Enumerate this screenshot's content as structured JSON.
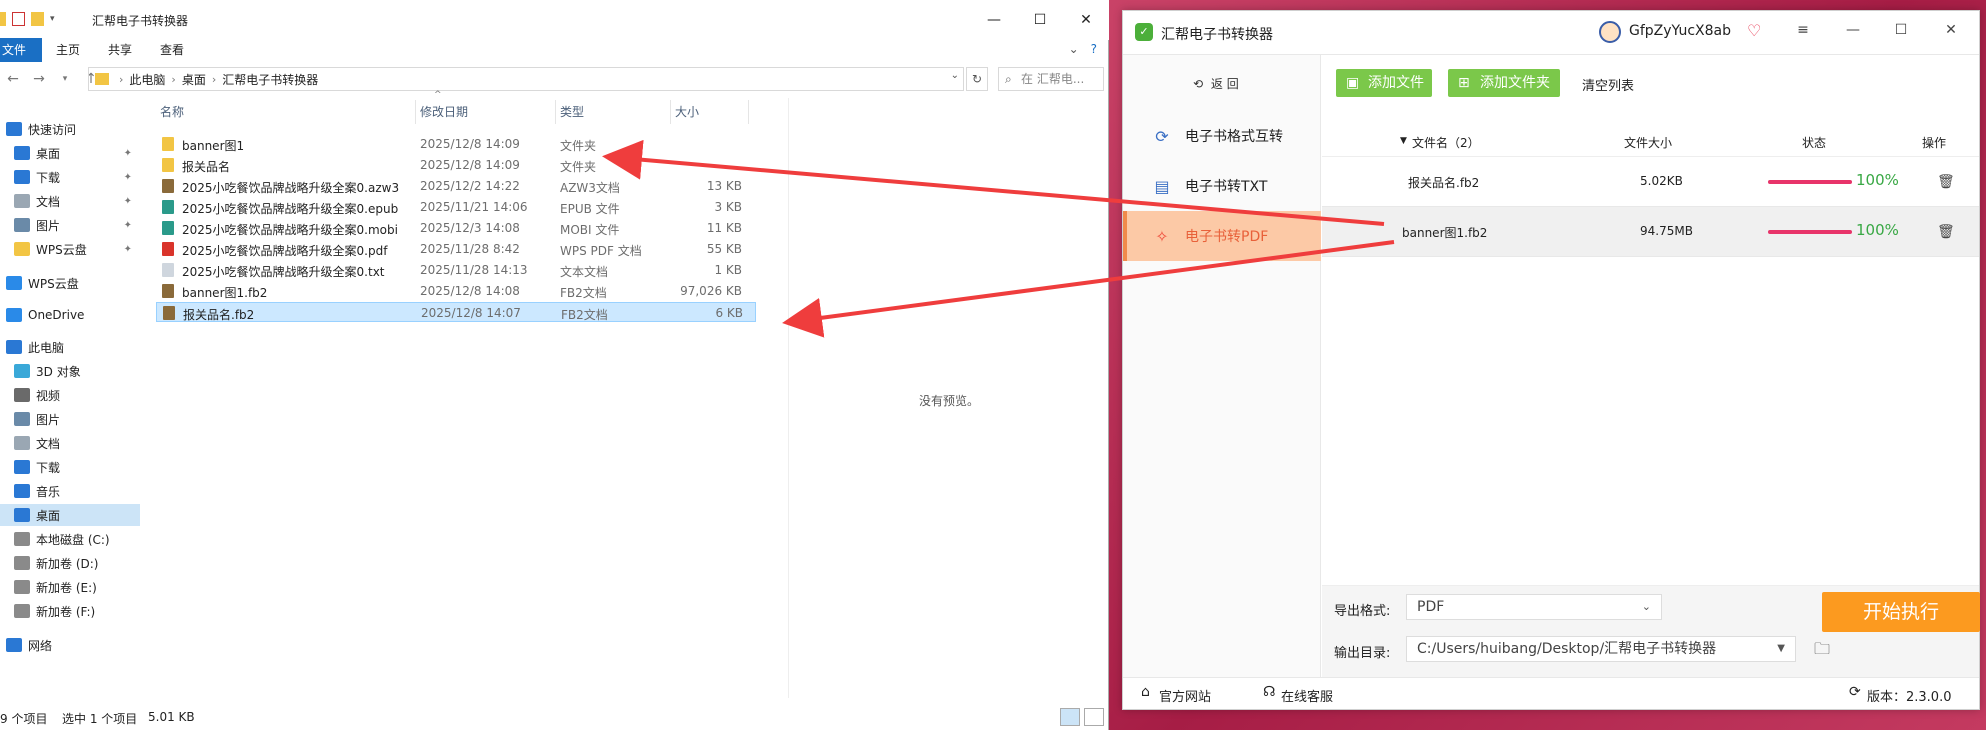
{
  "explorer": {
    "title": "汇帮电子书转换器",
    "ribbon": {
      "file": "文件",
      "home": "主页",
      "share": "共享",
      "view": "查看"
    },
    "breadcrumbs": [
      "此电脑",
      "桌面",
      "汇帮电子书转换器"
    ],
    "search_placeholder": "在 汇帮电...",
    "sidebar": [
      {
        "label": "快速访问",
        "icon": "star-icon"
      },
      {
        "label": "桌面",
        "icon": "desktop-icon"
      },
      {
        "label": "下载",
        "icon": "download-icon"
      },
      {
        "label": "文档",
        "icon": "document-icon"
      },
      {
        "label": "图片",
        "icon": "picture-icon"
      },
      {
        "label": "WPS云盘",
        "icon": "folder-icon"
      },
      {
        "label": "WPS云盘",
        "icon": "cloud-icon"
      },
      {
        "label": "OneDrive",
        "icon": "cloud-icon"
      },
      {
        "label": "此电脑",
        "icon": "computer-icon"
      },
      {
        "label": "3D 对象",
        "icon": "cube-icon"
      },
      {
        "label": "视频",
        "icon": "video-icon"
      },
      {
        "label": "图片",
        "icon": "picture-icon"
      },
      {
        "label": "文档",
        "icon": "document-icon"
      },
      {
        "label": "下载",
        "icon": "download-icon"
      },
      {
        "label": "音乐",
        "icon": "music-icon"
      },
      {
        "label": "桌面",
        "icon": "desktop-icon"
      },
      {
        "label": "本地磁盘 (C:)",
        "icon": "drive-icon"
      },
      {
        "label": "新加卷 (D:)",
        "icon": "drive-icon"
      },
      {
        "label": "新加卷 (E:)",
        "icon": "drive-icon"
      },
      {
        "label": "新加卷 (F:)",
        "icon": "drive-icon"
      },
      {
        "label": "网络",
        "icon": "network-icon"
      }
    ],
    "columns": {
      "name": "名称",
      "date": "修改日期",
      "type": "类型",
      "size": "大小"
    },
    "files": [
      {
        "name": "banner图1",
        "date": "2025/12/8 14:09",
        "type": "文件夹",
        "size": "",
        "icon_color": "#f2c544"
      },
      {
        "name": "报关品名",
        "date": "2025/12/8 14:09",
        "type": "文件夹",
        "size": "",
        "icon_color": "#f2c544"
      },
      {
        "name": "2025小吃餐饮品牌战略升级全案0.azw3",
        "date": "2025/12/2 14:22",
        "type": "AZW3文档",
        "size": "13 KB",
        "icon_color": "#8a6a3a"
      },
      {
        "name": "2025小吃餐饮品牌战略升级全案0.epub",
        "date": "2025/11/21 14:06",
        "type": "EPUB 文件",
        "size": "3 KB",
        "icon_color": "#2a9a8a"
      },
      {
        "name": "2025小吃餐饮品牌战略升级全案0.mobi",
        "date": "2025/12/3 14:08",
        "type": "MOBI 文件",
        "size": "11 KB",
        "icon_color": "#2a9a8a"
      },
      {
        "name": "2025小吃餐饮品牌战略升级全案0.pdf",
        "date": "2025/11/28 8:42",
        "type": "WPS PDF 文档",
        "size": "55 KB",
        "icon_color": "#d9342b"
      },
      {
        "name": "2025小吃餐饮品牌战略升级全案0.txt",
        "date": "2025/11/28 14:13",
        "type": "文本文档",
        "size": "1 KB",
        "icon_color": "#cfd6de"
      },
      {
        "name": "banner图1.fb2",
        "date": "2025/12/8 14:08",
        "type": "FB2文档",
        "size": "97,026 KB",
        "icon_color": "#8a6a3a"
      },
      {
        "name": "报关品名.fb2",
        "date": "2025/12/8 14:07",
        "type": "FB2文档",
        "size": "6 KB",
        "icon_color": "#8a6a3a"
      }
    ],
    "preview_text": "没有预览。",
    "status": {
      "count": "9 个项目",
      "selected": "选中 1 个项目",
      "size": "5.01 KB"
    }
  },
  "app": {
    "title": "汇帮电子书转换器",
    "username": "GfpZyYucX8ab",
    "back_label": "返 回",
    "nav": [
      {
        "label": "电子书格式互转",
        "icon": "refresh-icon"
      },
      {
        "label": "电子书转TXT",
        "icon": "txt-doc-icon"
      },
      {
        "label": "电子书转PDF",
        "icon": "pdf-icon"
      }
    ],
    "toolbar": {
      "add_file": "添加文件",
      "add_folder": "添加文件夹",
      "clear": "清空列表"
    },
    "table_head": {
      "name": "文件名（2）",
      "size": "文件大小",
      "status": "状态",
      "action": "操作"
    },
    "rows": [
      {
        "name": "报关品名.fb2",
        "size": "5.02KB",
        "progress": 100,
        "pct": "100%"
      },
      {
        "name": "banner图1.fb2",
        "size": "94.75MB",
        "progress": 100,
        "pct": "100%"
      }
    ],
    "options": {
      "format_label": "导出格式:",
      "format_value": "PDF",
      "dir_label": "输出目录:",
      "dir_value": "C:/Users/huibang/Desktop/汇帮电子书转换器",
      "start": "开始执行"
    },
    "footer": {
      "website": "官方网站",
      "service": "在线客服",
      "version": "版本：2.3.0.0"
    },
    "colors": {
      "accent_green": "#7bc84a",
      "accent_orange": "#fc9a1f",
      "active_nav": "#fcc9a6",
      "progress": "#e8346a",
      "pct_green": "#39a845"
    }
  }
}
